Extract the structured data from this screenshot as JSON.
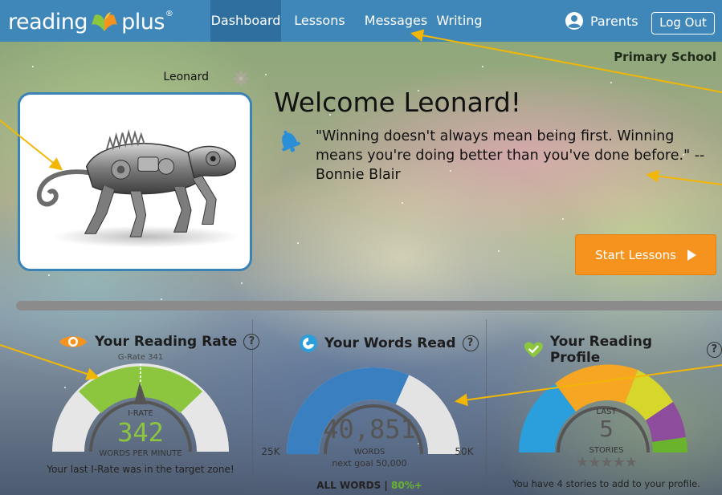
{
  "brand": {
    "left": "reading",
    "right": "plus",
    "mark": "®"
  },
  "nav": {
    "items": [
      {
        "label": "Dashboard",
        "active": true
      },
      {
        "label": "Lessons",
        "active": false
      },
      {
        "label": "Messages",
        "active": false
      },
      {
        "label": "Writing",
        "active": false
      }
    ],
    "parents_label": "Parents",
    "logout_label": "Log Out"
  },
  "header": {
    "school": "Primary School",
    "student_name": "Leonard",
    "welcome": "Welcome Leonard!",
    "quote": "\"Winning doesn't always mean being first. Winning means you're doing better than you've done before.\" -- Bonnie Blair",
    "start_label": "Start Lessons"
  },
  "reading_rate": {
    "title": "Your Reading Rate",
    "help": "?",
    "g_rate": "G-Rate 341",
    "i_rate_label": "I-RATE",
    "i_rate_value": "342",
    "unit": "WORDS PER MINUTE",
    "caption": "Your last I-Rate was in the target zone!"
  },
  "words_read": {
    "title": "Your Words Read",
    "help": "?",
    "value": "40,851",
    "unit": "WORDS",
    "next_goal": "next goal 50,000",
    "min_label": "25K",
    "max_label": "50K",
    "filter_prefix": "ALL WORDS | ",
    "filter_value": "80%+",
    "progress": 0.634
  },
  "reading_profile": {
    "title": "Your Reading Profile",
    "help": "?",
    "last_label": "LAST",
    "count": "5",
    "stories_label": "STORIES",
    "stars": "★★★★★",
    "caption": "You have 4 stories to add to your profile."
  },
  "colors": {
    "nav": "#3f87b9",
    "accent_orange": "#f6931e",
    "rate_green": "#8cc63f",
    "words_blue": "#3a7fbf",
    "percent_green": "#6ab42d",
    "profile_segments": [
      "#2a9fdc",
      "#f6a623",
      "#d6d72a",
      "#8e4d9c",
      "#6ab42d"
    ]
  }
}
